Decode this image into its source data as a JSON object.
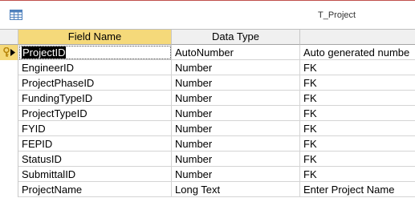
{
  "window": {
    "title": "T_Project",
    "accent": "#c0504d"
  },
  "columns": {
    "field_name": "Field Name",
    "data_type": "Data Type",
    "description": ""
  },
  "rows": [
    {
      "field_name": "ProjectID",
      "data_type": "AutoNumber",
      "description": "Auto generated numbe"
    },
    {
      "field_name": "EngineerID",
      "data_type": "Number",
      "description": "FK"
    },
    {
      "field_name": "ProjectPhaseID",
      "data_type": "Number",
      "description": "FK"
    },
    {
      "field_name": "FundingTypeID",
      "data_type": "Number",
      "description": "FK"
    },
    {
      "field_name": "ProjectTypeID",
      "data_type": "Number",
      "description": "FK"
    },
    {
      "field_name": "FYID",
      "data_type": "Number",
      "description": "FK"
    },
    {
      "field_name": "FEPID",
      "data_type": "Number",
      "description": "FK"
    },
    {
      "field_name": "StatusID",
      "data_type": "Number",
      "description": "FK"
    },
    {
      "field_name": "SubmittalID",
      "data_type": "Number",
      "description": "FK"
    },
    {
      "field_name": "ProjectName",
      "data_type": "Long Text",
      "description": "Enter Project Name"
    }
  ],
  "icons": {
    "table": "table-icon",
    "primary_key": "primary-key-icon",
    "current_row": "current-row-arrow-icon"
  },
  "colors": {
    "selected_header": "#f5d97a",
    "header": "#f0f0f0",
    "grid_line": "#d4d4d4"
  }
}
